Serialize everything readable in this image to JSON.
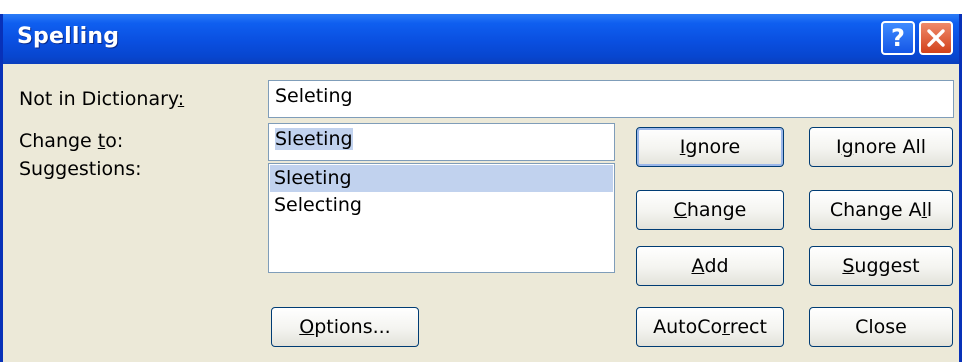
{
  "window": {
    "title": "Spelling",
    "help_glyph": "?"
  },
  "not_in_dictionary": {
    "label_pre": "Not in Dictionary",
    "label_hotkey": ":",
    "value": "Seleting"
  },
  "change_to": {
    "label_pre": "Change ",
    "label_hotkey": "t",
    "label_post": "o:",
    "value": "Sleeting"
  },
  "suggestions": {
    "label": "Suggestions:",
    "items": [
      "Sleeting",
      "Selecting"
    ],
    "selected_index": 0
  },
  "buttons": {
    "ignore": {
      "pre": "",
      "hotkey": "I",
      "post": "gnore"
    },
    "ignore_all": {
      "pre": "I",
      "hotkey": "g",
      "post": "nore All"
    },
    "change": {
      "pre": "",
      "hotkey": "C",
      "post": "hange"
    },
    "change_all": {
      "pre": "Change A",
      "hotkey": "l",
      "post": "l"
    },
    "add": {
      "pre": "",
      "hotkey": "A",
      "post": "dd"
    },
    "suggest": {
      "pre": "",
      "hotkey": "S",
      "post": "uggest"
    },
    "options": {
      "pre": "",
      "hotkey": "O",
      "post": "ptions..."
    },
    "autocorrect": {
      "pre": "AutoCo",
      "hotkey": "r",
      "post": "rect"
    },
    "close": {
      "label": "Close"
    }
  },
  "colors": {
    "titlebar": "#0a4fe0",
    "dialog_face": "#ece9d8",
    "selection": "#c1d2ee",
    "close_button": "#d2421c"
  },
  "icons": {
    "help": "help-icon",
    "close": "close-icon"
  }
}
